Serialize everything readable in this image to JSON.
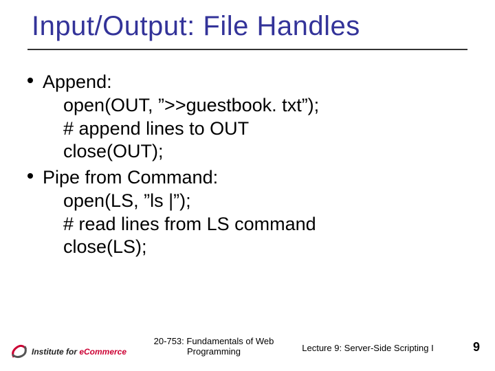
{
  "title": "Input/Output: File Handles",
  "bullets": [
    {
      "label": "Append:",
      "lines": [
        "open(OUT, ”>>guestbook. txt”);",
        "# append lines to OUT",
        "close(OUT);"
      ]
    },
    {
      "label": "Pipe from Command:",
      "lines": [
        "open(LS, ”ls |”);",
        "# read lines from LS command",
        "close(LS);"
      ]
    }
  ],
  "footer": {
    "logo_prefix": "Institute for ",
    "logo_word": "eCommerce",
    "course": "20-753: Fundamentals of Web Programming",
    "lecture": "Lecture 9: Server-Side Scripting I",
    "page": "9"
  }
}
